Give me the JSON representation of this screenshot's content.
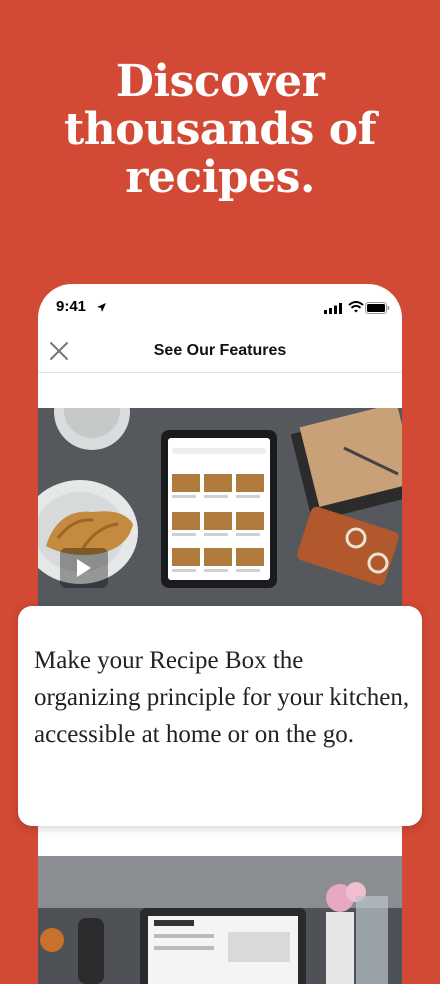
{
  "headline": {
    "line1": "Discover",
    "line2": "thousands of",
    "line3": "recipes."
  },
  "status_bar": {
    "time": "9:41"
  },
  "nav": {
    "title": "See Our Features"
  },
  "feature_card": {
    "text": "Make your Recipe Box the organizing principle for your kitchen, accessible at home or on the go."
  },
  "colors": {
    "background": "#d24a35",
    "card": "#ffffff",
    "text": "#222222"
  },
  "icons": [
    "location-arrow-icon",
    "cellular-signal-icon",
    "wifi-icon",
    "battery-icon",
    "close-icon",
    "play-icon"
  ]
}
